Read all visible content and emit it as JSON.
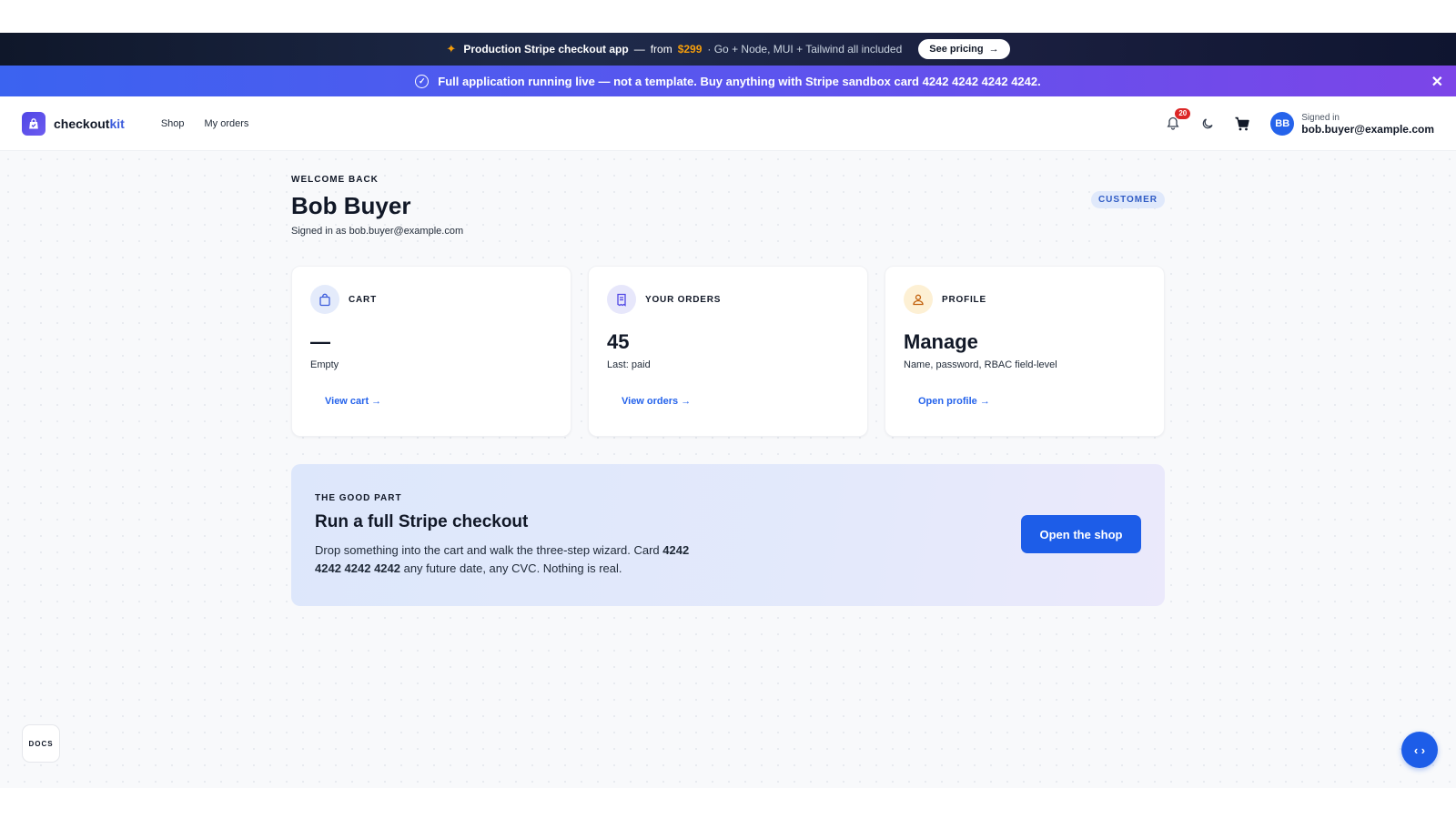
{
  "promo_bar": {
    "title": "Production Stripe checkout app",
    "dash": "—",
    "from": "from",
    "price": "$299",
    "details": "· Go + Node, MUI + Tailwind all included",
    "button": "See pricing"
  },
  "notice_bar": {
    "text": "Full application running live — not a template. Buy anything with Stripe sandbox card 4242  4242  4242  4242."
  },
  "nav": {
    "logo_main": "checkout",
    "logo_accent": "kit",
    "links": [
      "Shop",
      "My orders"
    ],
    "notification_count": "20",
    "user_label": "Signed in",
    "user_email": "bob.buyer@example.com",
    "avatar_initials": "BB"
  },
  "welcome": {
    "eyebrow": "WELCOME BACK",
    "name": "Bob Buyer",
    "signed_in": "Signed in as bob.buyer@example.com",
    "role": "CUSTOMER"
  },
  "cards": [
    {
      "title": "CART",
      "value": "—",
      "subtitle": "Empty",
      "link": "View cart →",
      "icon": "shopping-bag-icon"
    },
    {
      "title": "YOUR ORDERS",
      "value": "45",
      "subtitle": "Last: paid",
      "link": "View orders →",
      "icon": "receipt-icon"
    },
    {
      "title": "PROFILE",
      "value": "Manage",
      "subtitle": "Name, password, RBAC field-level",
      "link": "Open profile →",
      "icon": "user-icon"
    }
  ],
  "promo_card": {
    "eyebrow": "THE GOOD PART",
    "title": "Run a full Stripe checkout",
    "text_before": "Drop something into the cart and walk the three-step wizard. Card ",
    "card_number": "4242  4242  4242  4242",
    "text_after": " any future date, any CVC. Nothing is real.",
    "button": "Open the shop"
  },
  "floating": {
    "docs": "DOCS",
    "code": "‹ ›"
  },
  "colors": {
    "accent": "#1d5de8",
    "price": "#f59e0b",
    "badge": "#dc2626"
  }
}
